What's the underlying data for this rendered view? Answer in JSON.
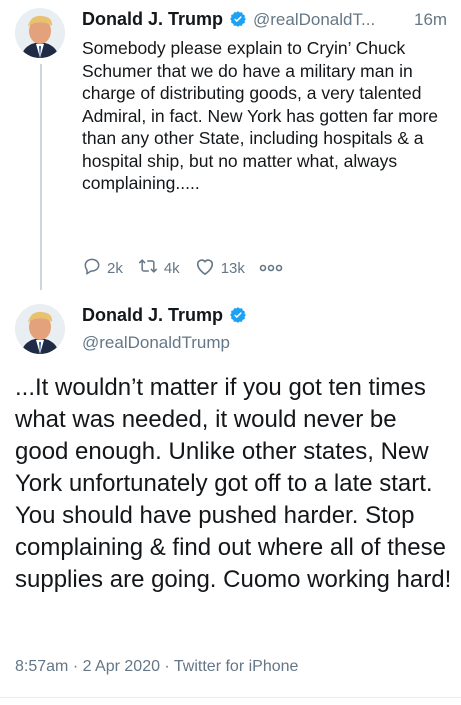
{
  "tweet1": {
    "author_name": "Donald J. Trump",
    "handle": "@realDonaldT...",
    "time": "16m",
    "text": "Somebody please explain to Cryin’ Chuck Schumer that we do have a military man in charge of distributing goods, a very talented Admiral, in fact. New York has gotten far more than any other State, including hospitals & a hospital ship, but no matter what, always complaining.....",
    "replies": "2k",
    "retweets": "4k",
    "likes": "13k"
  },
  "tweet2": {
    "author_name": "Donald J. Trump",
    "handle": "@realDonaldTrump",
    "text": "...It wouldn’t matter if you got ten times what was needed, it would never be good enough. Unlike other states, New York unfortunately got off to a late start. You should have pushed harder. Stop complaining & find out where all of these supplies are going. Cuomo working hard!",
    "timestamp": "8:57am · 2 Apr 2020 · Twitter for iPhone"
  },
  "colors": {
    "text": "#14171a",
    "secondary": "#657786",
    "verified": "#1da1f2",
    "thread_line": "#ccd6dd"
  },
  "icons": [
    "verified-badge-icon",
    "reply-icon",
    "retweet-icon",
    "like-icon",
    "more-icon"
  ]
}
